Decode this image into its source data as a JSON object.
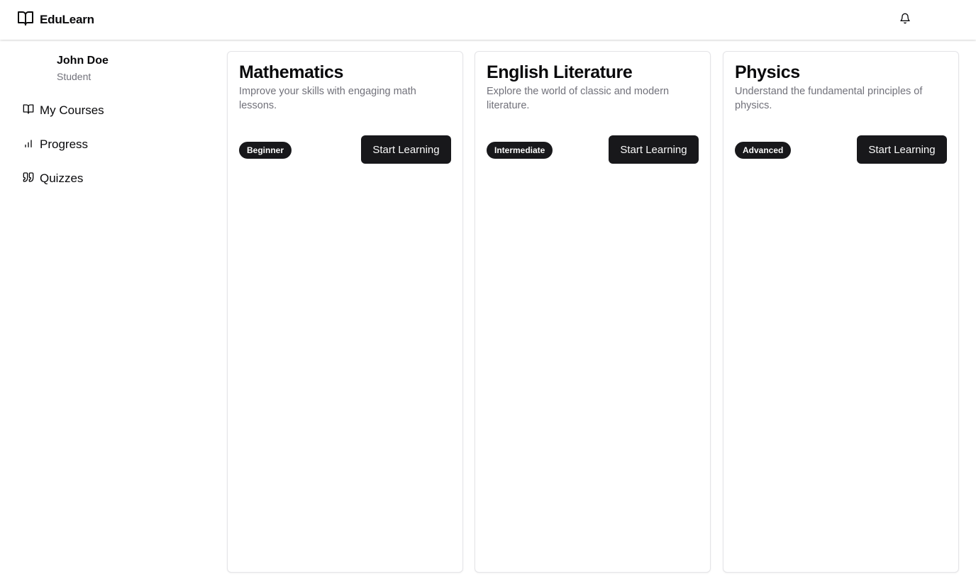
{
  "header": {
    "brand_name": "EduLearn",
    "brand_icon": "book-open-icon",
    "notification_icon": "bell-icon"
  },
  "sidebar": {
    "user": {
      "name": "John Doe",
      "role": "Student"
    },
    "items": [
      {
        "label": "My Courses",
        "icon": "book-open-icon"
      },
      {
        "label": "Progress",
        "icon": "bar-chart-icon"
      },
      {
        "label": "Quizzes",
        "icon": "quote-icon"
      }
    ]
  },
  "courses": [
    {
      "title": "Mathematics",
      "description": "Improve your skills with engaging math lessons.",
      "level": "Beginner",
      "action": "Start Learning"
    },
    {
      "title": "English Literature",
      "description": "Explore the world of classic and modern literature.",
      "level": "Intermediate",
      "action": "Start Learning"
    },
    {
      "title": "Physics",
      "description": "Understand the fundamental principles of physics.",
      "level": "Advanced",
      "action": "Start Learning"
    }
  ],
  "colors": {
    "primary": "#18181b",
    "muted_text": "#71717a",
    "border": "#e4e4e7"
  }
}
